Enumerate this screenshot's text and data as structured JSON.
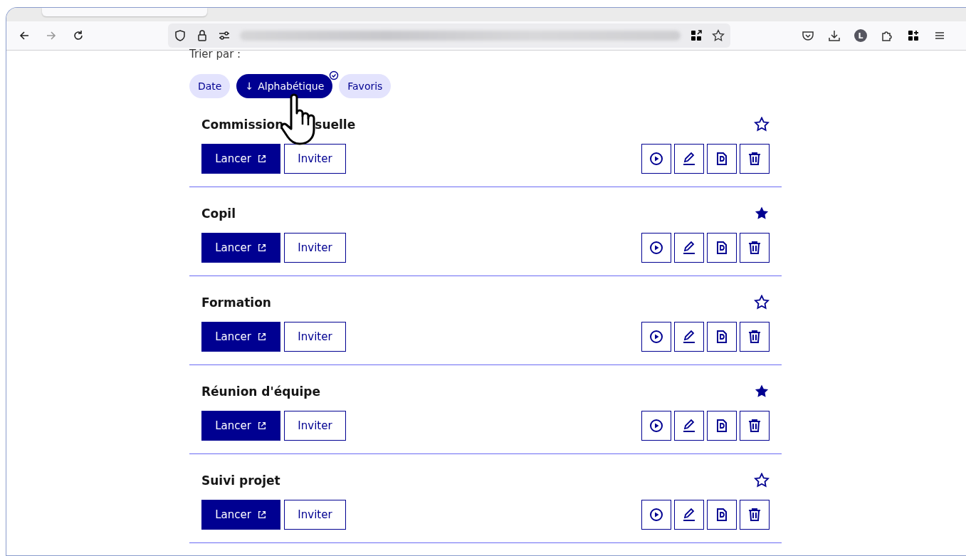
{
  "browser": {
    "profile_initial": "L"
  },
  "sort": {
    "label": "Trier par :",
    "options": [
      {
        "label": "Date",
        "selected": false
      },
      {
        "label": "Alphabétique",
        "selected": true,
        "arrow": "↓"
      },
      {
        "label": "Favoris",
        "selected": false
      }
    ]
  },
  "meetings": [
    {
      "title_parts": [
        "Commission",
        "suelle"
      ],
      "favorite": false,
      "launch_label": "Lancer",
      "invite_label": "Inviter"
    },
    {
      "title_parts": [
        "Copil"
      ],
      "favorite": true,
      "launch_label": "Lancer",
      "invite_label": "Inviter"
    },
    {
      "title_parts": [
        "Formation"
      ],
      "favorite": false,
      "launch_label": "Lancer",
      "invite_label": "Inviter"
    },
    {
      "title_parts": [
        "Réunion d'équipe"
      ],
      "favorite": true,
      "launch_label": "Lancer",
      "invite_label": "Inviter"
    },
    {
      "title_parts": [
        "Suivi projet"
      ],
      "favorite": false,
      "launch_label": "Lancer",
      "invite_label": "Inviter"
    }
  ]
}
